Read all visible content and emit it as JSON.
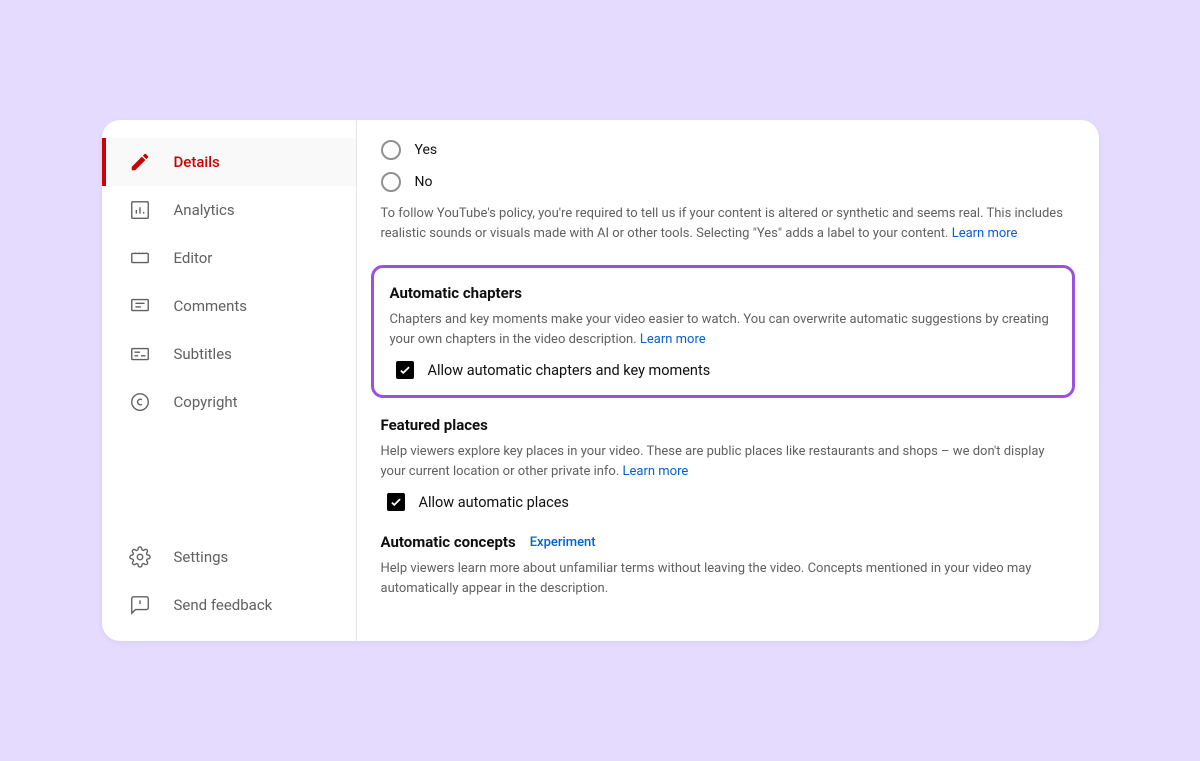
{
  "sidebar": {
    "items": [
      {
        "label": "Details"
      },
      {
        "label": "Analytics"
      },
      {
        "label": "Editor"
      },
      {
        "label": "Comments"
      },
      {
        "label": "Subtitles"
      },
      {
        "label": "Copyright"
      }
    ],
    "footer": [
      {
        "label": "Settings"
      },
      {
        "label": "Send feedback"
      }
    ]
  },
  "radios": {
    "yes": "Yes",
    "no": "No"
  },
  "policy": {
    "text": "To follow YouTube's policy, you're required to tell us if your content is altered or synthetic and seems real. This includes realistic sounds or visuals made with AI or other tools. Selecting \"Yes\" adds a label to your content. ",
    "link": "Learn more"
  },
  "chapters": {
    "title": "Automatic chapters",
    "desc": "Chapters and key moments make your video easier to watch. You can overwrite automatic suggestions by creating your own chapters in the video description. ",
    "link": "Learn more",
    "checkbox": "Allow automatic chapters and key moments"
  },
  "places": {
    "title": "Featured places",
    "desc": "Help viewers explore key places in your video. These are public places like restaurants and shops – we don't display your current location or other private info. ",
    "link": "Learn more",
    "checkbox": "Allow automatic places"
  },
  "concepts": {
    "title": "Automatic concepts",
    "badge": "Experiment",
    "desc": "Help viewers learn more about unfamiliar terms without leaving the video. Concepts mentioned in your video may automatically appear in the description."
  }
}
